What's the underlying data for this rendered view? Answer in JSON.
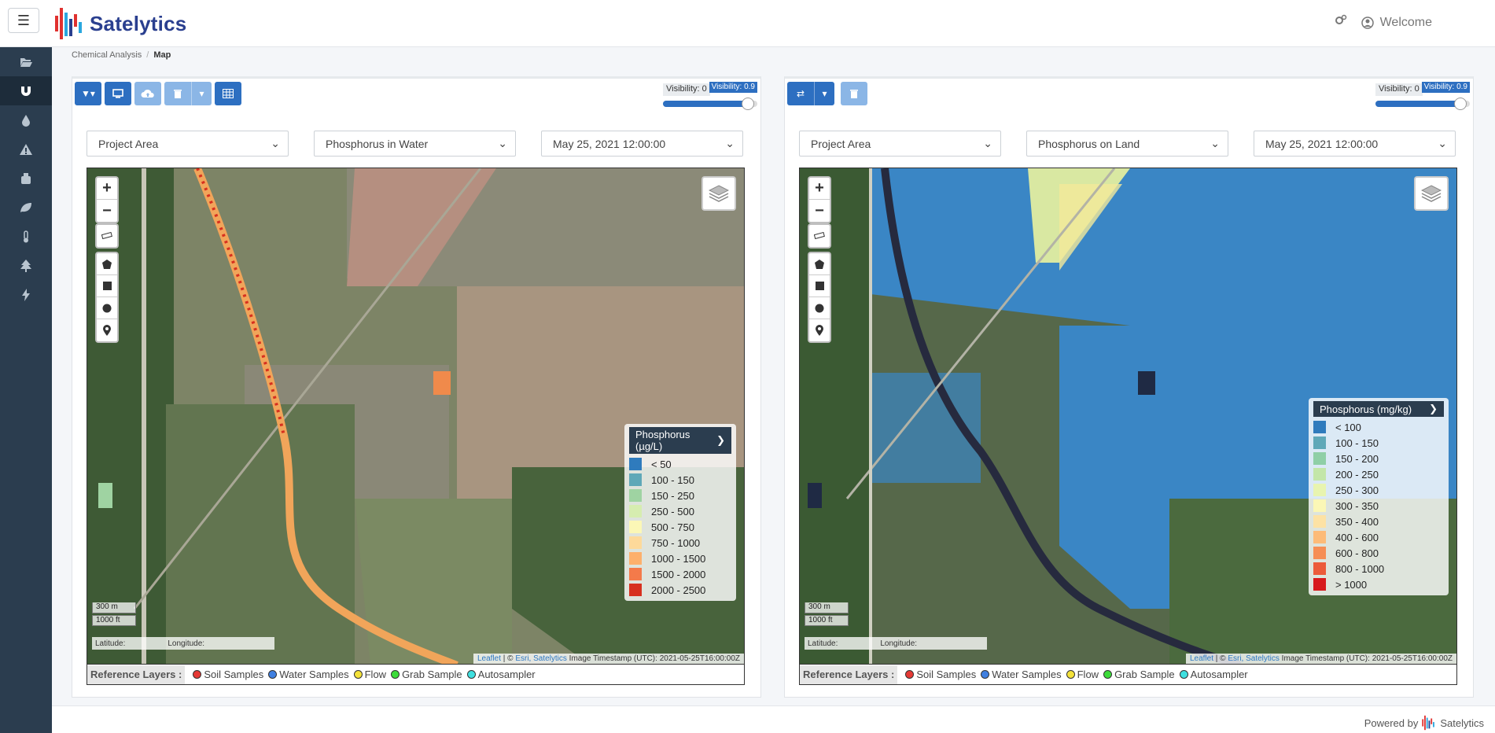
{
  "app": {
    "name": "Satelytics",
    "welcome": "Welcome"
  },
  "breadcrumb": {
    "parent": "Chemical Analysis",
    "current": "Map",
    "separator": "/"
  },
  "sidebar": {
    "icons": [
      "folder-open-icon",
      "magnet-icon",
      "droplet-icon",
      "warning-icon",
      "tank-icon",
      "leaf-icon",
      "thermometer-icon",
      "tree-icon",
      "bolt-icon"
    ],
    "active_index": 1
  },
  "left": {
    "visibility": {
      "min_label": "Visibility: 0",
      "value_label": "Visibility: 0.9",
      "value": 0.9
    },
    "selects": {
      "area": "Project Area",
      "analyte": "Phosphorus in Water",
      "datetime": "May 25, 2021 12:00:00"
    },
    "legend": {
      "title": "Phosphorus (µg/L)",
      "items": [
        {
          "label": "< 50",
          "color": "#2f7bbd"
        },
        {
          "label": "100 - 150",
          "color": "#5fa8b8"
        },
        {
          "label": "150 - 250",
          "color": "#9fd3a2"
        },
        {
          "label": "250 - 500",
          "color": "#d6edb0"
        },
        {
          "label": "500 - 750",
          "color": "#fbf7b6"
        },
        {
          "label": "750 - 1000",
          "color": "#fdd99a"
        },
        {
          "label": "1000 - 1500",
          "color": "#fdb06c"
        },
        {
          "label": "1500 - 2000",
          "color": "#f47a4a"
        },
        {
          "label": "2000 - 2500",
          "color": "#d7301f"
        }
      ]
    },
    "scale": {
      "m": "300 m",
      "ft": "1000 ft"
    },
    "latlon": {
      "lat": "Latitude:",
      "lon": "Longitude:"
    },
    "attribution": {
      "leaflet": "Leaflet",
      "sep": "| ©",
      "esri": "Esri,",
      "sat": "Satelytics",
      "ts": "Image Timestamp (UTC): 2021-05-25T16:00:00Z"
    }
  },
  "right": {
    "visibility": {
      "min_label": "Visibility: 0",
      "value_label": "Visibility: 0.9",
      "value": 0.9
    },
    "selects": {
      "area": "Project Area",
      "analyte": "Phosphorus on Land",
      "datetime": "May 25, 2021 12:00:00"
    },
    "legend": {
      "title": "Phosphorus (mg/kg)",
      "items": [
        {
          "label": "< 100",
          "color": "#2f7bbd"
        },
        {
          "label": "100 - 150",
          "color": "#5fa8b8"
        },
        {
          "label": "150 - 200",
          "color": "#8fcfa6"
        },
        {
          "label": "200 - 250",
          "color": "#c3e6a8"
        },
        {
          "label": "250 - 300",
          "color": "#e8f4b0"
        },
        {
          "label": "300 - 350",
          "color": "#fbf7b6"
        },
        {
          "label": "350 - 400",
          "color": "#fde2a4"
        },
        {
          "label": "400 - 600",
          "color": "#fdbb78"
        },
        {
          "label": "600 - 800",
          "color": "#f68e55"
        },
        {
          "label": "800 - 1000",
          "color": "#ec5a3a"
        },
        {
          "label": "> 1000",
          "color": "#d7191c"
        }
      ]
    },
    "scale": {
      "m": "300 m",
      "ft": "1000 ft"
    },
    "latlon": {
      "lat": "Latitude:",
      "lon": "Longitude:"
    },
    "attribution": {
      "leaflet": "Leaflet",
      "sep": "| ©",
      "esri": "Esri,",
      "sat": "Satelytics",
      "ts": "Image Timestamp (UTC): 2021-05-25T16:00:00Z"
    }
  },
  "reference": {
    "label": "Reference Layers :",
    "items": [
      {
        "label": "Soil Samples",
        "color": "#e53935"
      },
      {
        "label": "Water Samples",
        "color": "#3f7fe0"
      },
      {
        "label": "Flow",
        "color": "#f4e23a"
      },
      {
        "label": "Grab Sample",
        "color": "#3ddc3a"
      },
      {
        "label": "Autosampler",
        "color": "#3fe0e0"
      }
    ]
  },
  "footer": {
    "powered": "Powered by",
    "brand": "Satelytics"
  }
}
